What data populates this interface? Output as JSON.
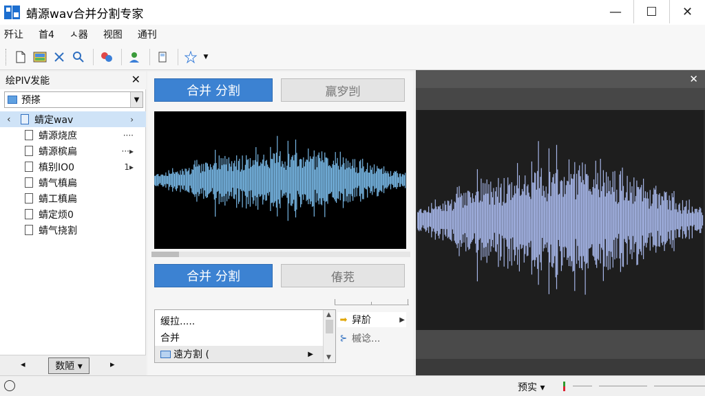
{
  "window": {
    "title": "蜻源wav合并分割专家",
    "minimize": "—",
    "maximize": "☐",
    "close": "✕"
  },
  "menu": [
    "歼让",
    "首4",
    "ㅅ器",
    "视图",
    "通刊"
  ],
  "toolbar": {
    "icons": [
      "new-file-icon",
      "image-icon",
      "cut-icon",
      "search-icon",
      "effects-icon",
      "user-icon",
      "device-icon",
      "star-icon"
    ]
  },
  "left_panel": {
    "title": "绘PIV发能",
    "close": "✕",
    "combo_value": "预搽",
    "tree": [
      {
        "label": "蜻定wav",
        "badge": "›",
        "selected": true
      },
      {
        "label": "蜻源烧庶",
        "badge": "····"
      },
      {
        "label": "蜻源槟扁",
        "badge": "···▸"
      },
      {
        "label": "槙别IO0",
        "badge": "1▸"
      },
      {
        "label": "蜻气槙扁",
        "badge": ""
      },
      {
        "label": "蜻工槙扁",
        "badge": ""
      },
      {
        "label": "蜻定烦0",
        "badge": ""
      },
      {
        "label": "蜻气挠割",
        "badge": ""
      }
    ],
    "footer_left": "◂",
    "footer_button": "数陋 ▾",
    "footer_right": "▸"
  },
  "middle": {
    "btn_merge_split_1": "合并 分割",
    "btn_gray_1": "羸穸剀",
    "btn_merge_split_2": "合并 分割",
    "btn_gray_2": "偆茺",
    "list": [
      "缓拉.....",
      "合并",
      "遠方割 ("
    ],
    "context": [
      "舁斺",
      "槭谂..."
    ]
  },
  "right_panel": {
    "close": "✕"
  },
  "statusbar": {
    "preview_label": "预实 ▾"
  }
}
